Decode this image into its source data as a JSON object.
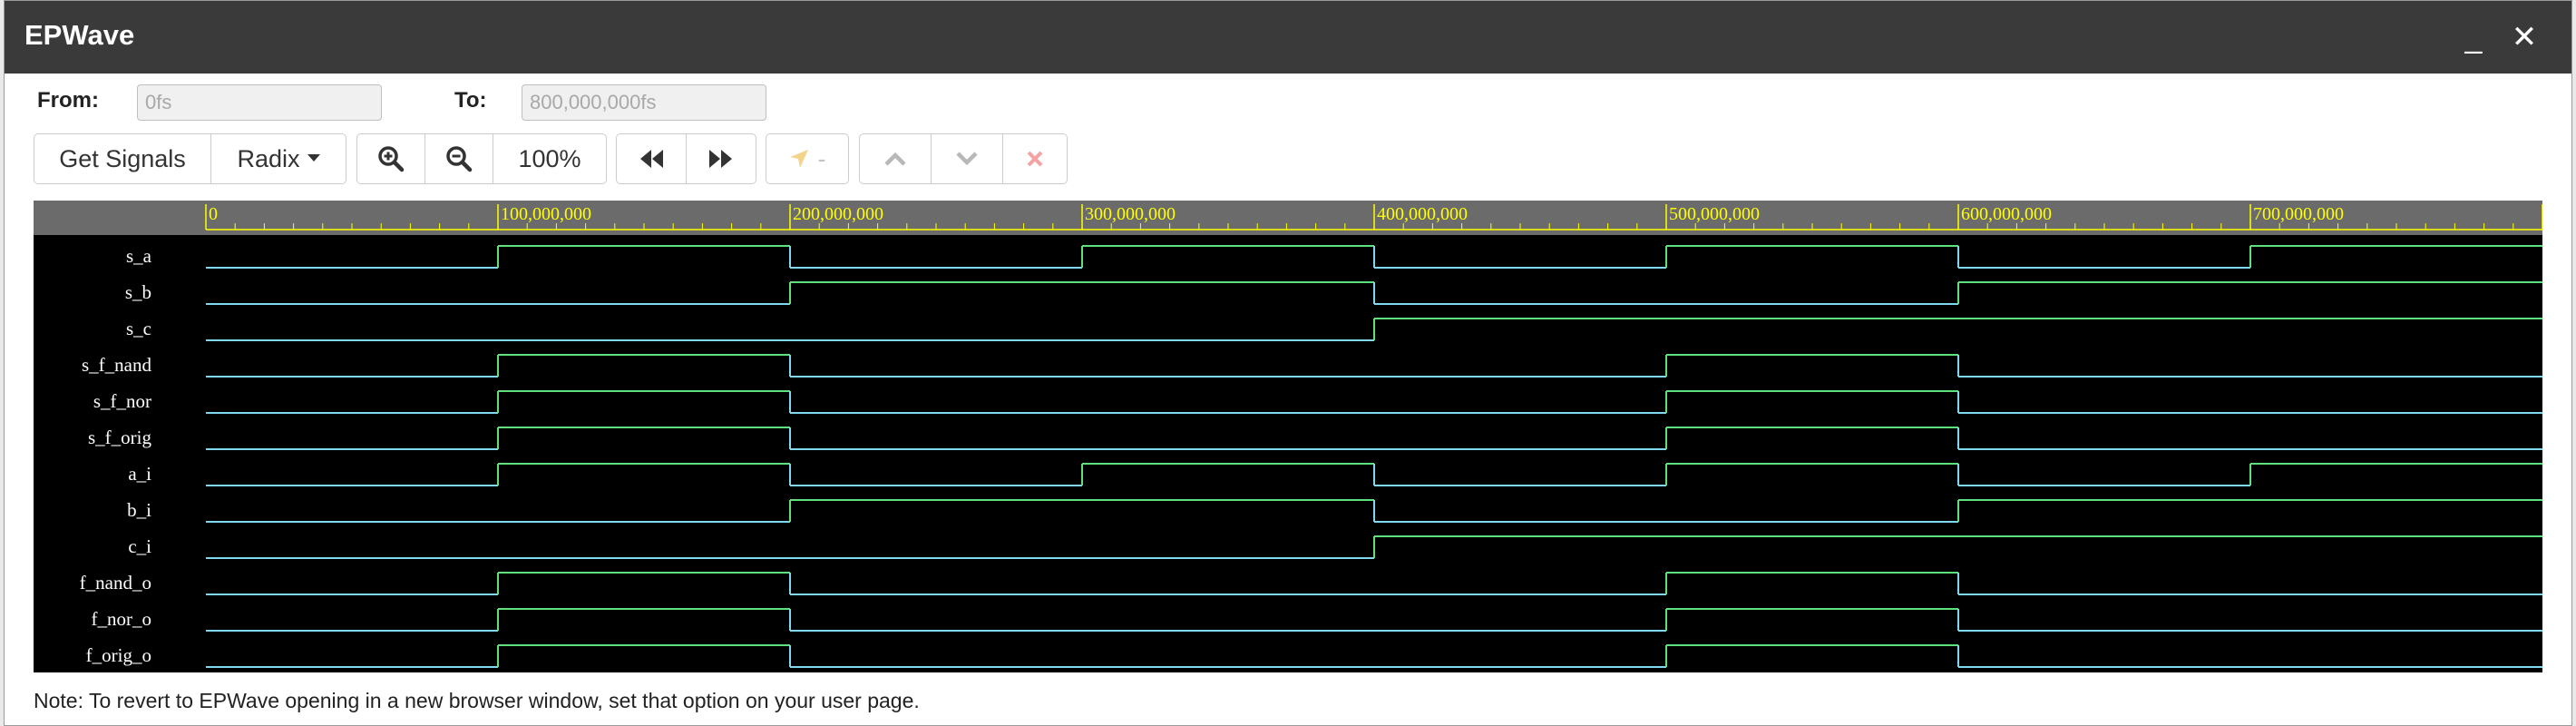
{
  "window": {
    "title": "EPWave",
    "minimize_icon": "minimize-icon",
    "close_icon": "close-icon",
    "minimize_glyph": "_",
    "close_glyph": "✕"
  },
  "range": {
    "from_label": "From:",
    "from_placeholder": "0fs",
    "to_label": "To:",
    "to_placeholder": "800,000,000fs"
  },
  "toolbar": {
    "get_signals": "Get Signals",
    "radix": "Radix",
    "zoom_level": "100%",
    "marker_dash": "-"
  },
  "waveform": {
    "time_start": 0,
    "time_end": 800000000,
    "time_unit": "fs",
    "ruler_labels": [
      "0",
      "100,000,000",
      "200,000,000",
      "300,000,000",
      "400,000,000",
      "500,000,000",
      "600,000,000",
      "700,000,000"
    ],
    "colors": {
      "low": "#7fd8f0",
      "high": "#5ee07a",
      "ruler_text": "#ffff00",
      "ruler_band": "#6b6b6b",
      "background": "#000000"
    },
    "signals": [
      {
        "name": "s_a",
        "values": [
          0,
          1,
          0,
          1,
          0,
          1,
          0,
          1
        ]
      },
      {
        "name": "s_b",
        "values": [
          0,
          0,
          1,
          1,
          0,
          0,
          1,
          1
        ]
      },
      {
        "name": "s_c",
        "values": [
          0,
          0,
          0,
          0,
          1,
          1,
          1,
          1
        ]
      },
      {
        "name": "s_f_nand",
        "values": [
          0,
          1,
          0,
          0,
          0,
          1,
          0,
          0
        ]
      },
      {
        "name": "s_f_nor",
        "values": [
          0,
          1,
          0,
          0,
          0,
          1,
          0,
          0
        ]
      },
      {
        "name": "s_f_orig",
        "values": [
          0,
          1,
          0,
          0,
          0,
          1,
          0,
          0
        ]
      },
      {
        "name": "a_i",
        "values": [
          0,
          1,
          0,
          1,
          0,
          1,
          0,
          1
        ]
      },
      {
        "name": "b_i",
        "values": [
          0,
          0,
          1,
          1,
          0,
          0,
          1,
          1
        ]
      },
      {
        "name": "c_i",
        "values": [
          0,
          0,
          0,
          0,
          1,
          1,
          1,
          1
        ]
      },
      {
        "name": "f_nand_o",
        "values": [
          0,
          1,
          0,
          0,
          0,
          1,
          0,
          0
        ]
      },
      {
        "name": "f_nor_o",
        "values": [
          0,
          1,
          0,
          0,
          0,
          1,
          0,
          0
        ]
      },
      {
        "name": "f_orig_o",
        "values": [
          0,
          1,
          0,
          0,
          0,
          1,
          0,
          0
        ]
      }
    ]
  },
  "note": "Note: To revert to EPWave opening in a new browser window, set that option on your user page."
}
